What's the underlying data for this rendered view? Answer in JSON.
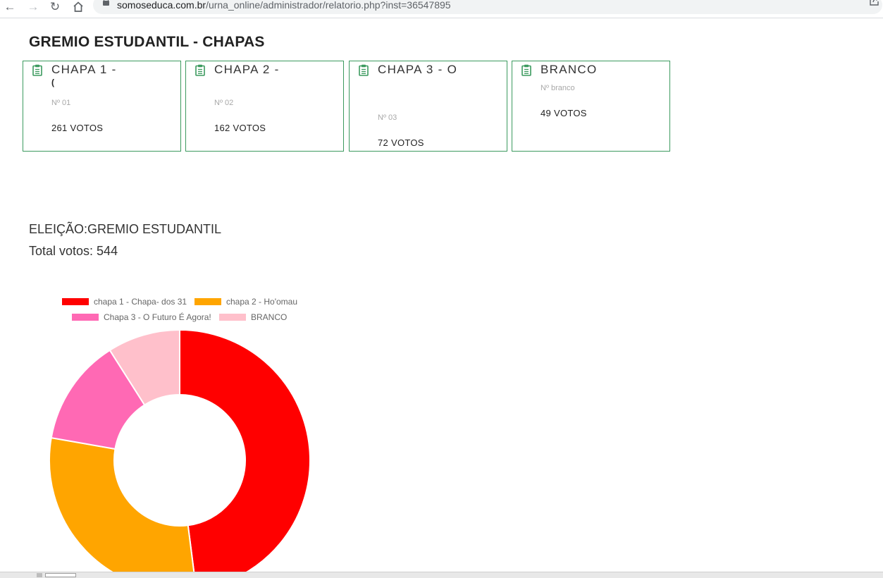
{
  "browser": {
    "url_host": "somoseduca.com.br",
    "url_path": "/urna_online/administrador/relatorio.php?inst=36547895"
  },
  "page": {
    "title": "GREMIO ESTUDANTIL - CHAPAS",
    "election_line": "ELEIÇÃO:GREMIO ESTUDANTIL",
    "total_line": "Total votos: 544"
  },
  "cards": [
    {
      "title": "CHAPA 1 -",
      "subtitle": "(",
      "number": "Nº 01",
      "votes": "261 VOTOS"
    },
    {
      "title": "CHAPA 2 -",
      "subtitle": "",
      "number": "Nº 02",
      "votes": "162 VOTOS"
    },
    {
      "title": "CHAPA 3 - O",
      "subtitle": "",
      "number": "Nº 03",
      "votes": "72 VOTOS"
    },
    {
      "title": "BRANCO",
      "subtitle": "",
      "number": "Nº branco",
      "votes": "49 VOTOS"
    }
  ],
  "colors": {
    "card_border": "#3c9a5f",
    "icon_green": "#3c9a5f"
  },
  "icons": {
    "back": "arrow-left-icon",
    "forward": "arrow-right-icon",
    "reload": "reload-icon",
    "home": "home-icon",
    "lock": "lock-icon",
    "share": "share-icon",
    "card": "clipboard-icon"
  },
  "chart_data": {
    "type": "doughnut",
    "title": "",
    "legend_position": "top",
    "categories": [
      "chapa 1 - Chapa- dos 31",
      "chapa 2 - Ho'omau",
      "Chapa 3 - O Futuro É Agora!",
      "BRANCO"
    ],
    "values": [
      261,
      162,
      72,
      49
    ],
    "colors": [
      "#ff0000",
      "#ffa500",
      "#ff69b4",
      "#ffc0cb"
    ]
  }
}
